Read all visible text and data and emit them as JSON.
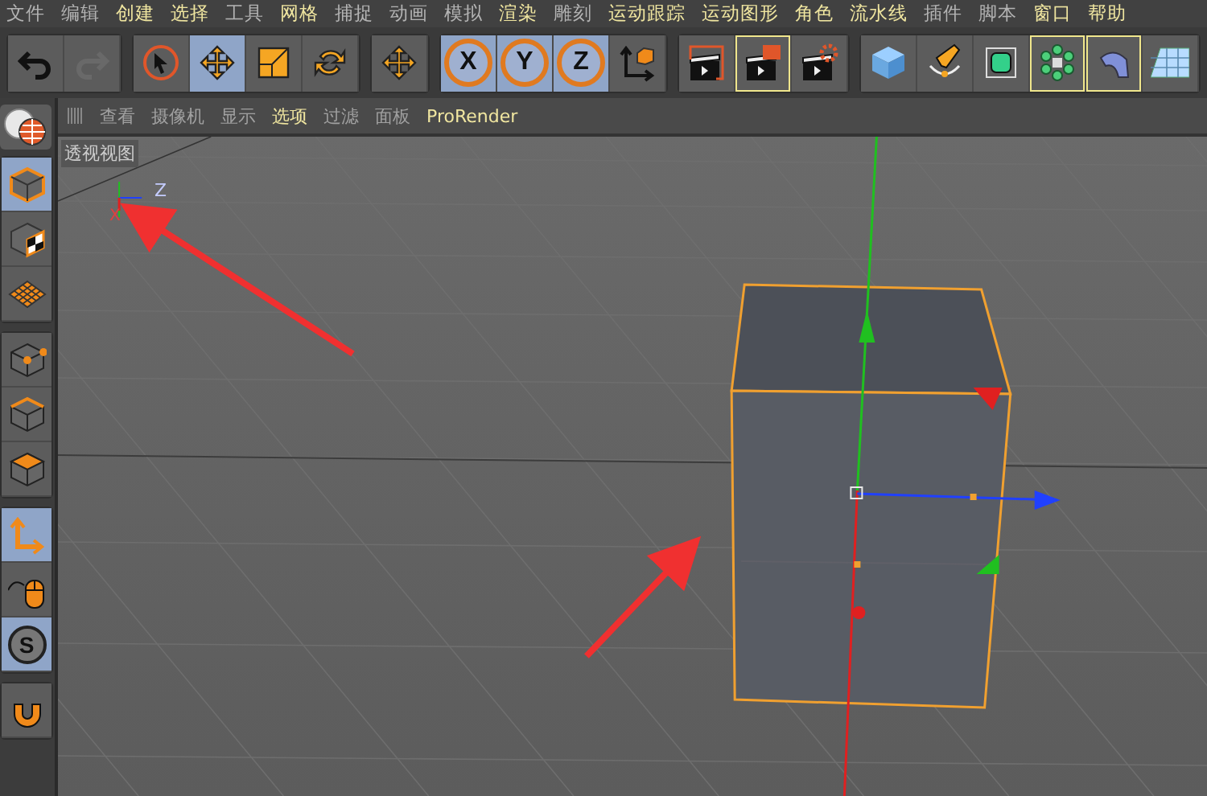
{
  "menu_bar": [
    {
      "label": "文件",
      "color": "#b4b4b4"
    },
    {
      "label": "编辑",
      "color": "#b4b4b4"
    },
    {
      "label": "创建",
      "color": "#f0e6a0"
    },
    {
      "label": "选择",
      "color": "#f0e6a0"
    },
    {
      "label": "工具",
      "color": "#b4b4b4"
    },
    {
      "label": "网格",
      "color": "#f0e6a0"
    },
    {
      "label": "捕捉",
      "color": "#b4b4b4"
    },
    {
      "label": "动画",
      "color": "#b4b4b4"
    },
    {
      "label": "模拟",
      "color": "#b4b4b4"
    },
    {
      "label": "渲染",
      "color": "#f0e6a0"
    },
    {
      "label": "雕刻",
      "color": "#b4b4b4"
    },
    {
      "label": "运动跟踪",
      "color": "#f0e6a0"
    },
    {
      "label": "运动图形",
      "color": "#f0e6a0"
    },
    {
      "label": "角色",
      "color": "#f0e6a0"
    },
    {
      "label": "流水线",
      "color": "#f0e6a0"
    },
    {
      "label": "插件",
      "color": "#b4b4b4"
    },
    {
      "label": "脚本",
      "color": "#b4b4b4"
    },
    {
      "label": "窗口",
      "color": "#f0e6a0"
    },
    {
      "label": "帮助",
      "color": "#f0e6a0"
    }
  ],
  "toolbar": [
    [
      {
        "kind": "undo",
        "selected": false,
        "outlined": false,
        "disabled": false
      },
      {
        "kind": "redo",
        "selected": false,
        "outlined": false,
        "disabled": true
      }
    ],
    [
      {
        "kind": "select",
        "selected": false,
        "outlined": false,
        "disabled": false
      },
      {
        "kind": "move",
        "selected": true,
        "outlined": false,
        "disabled": false
      },
      {
        "kind": "scale",
        "selected": false,
        "outlined": false,
        "disabled": false
      },
      {
        "kind": "rotate",
        "selected": false,
        "outlined": false,
        "disabled": false
      }
    ],
    [
      {
        "kind": "transform",
        "selected": false,
        "outlined": false,
        "disabled": false
      }
    ],
    [
      {
        "kind": "axis-letter",
        "label": "X",
        "selected": true,
        "outlined": false,
        "disabled": false
      },
      {
        "kind": "axis-letter",
        "label": "Y",
        "selected": true,
        "outlined": false,
        "disabled": false
      },
      {
        "kind": "axis-letter",
        "label": "Z",
        "selected": true,
        "outlined": false,
        "disabled": false
      },
      {
        "kind": "coords",
        "selected": false,
        "outlined": false,
        "disabled": false
      }
    ],
    [
      {
        "kind": "render-region",
        "selected": false,
        "outlined": false,
        "disabled": false
      },
      {
        "kind": "render-view",
        "selected": false,
        "outlined": true,
        "disabled": false
      },
      {
        "kind": "render-settings",
        "selected": false,
        "outlined": false,
        "disabled": false
      }
    ],
    [
      {
        "kind": "cube",
        "selected": false,
        "outlined": false,
        "disabled": false
      },
      {
        "kind": "pen",
        "selected": false,
        "outlined": false,
        "disabled": false
      },
      {
        "kind": "subdivision",
        "selected": false,
        "outlined": false,
        "disabled": false
      },
      {
        "kind": "cloner",
        "selected": false,
        "outlined": true,
        "disabled": false
      },
      {
        "kind": "bend",
        "selected": false,
        "outlined": true,
        "disabled": false
      },
      {
        "kind": "floor",
        "selected": false,
        "outlined": false,
        "disabled": false
      }
    ]
  ],
  "viewport_menu": [
    {
      "label": "查看",
      "color": "#a0a0a0"
    },
    {
      "label": "摄像机",
      "color": "#a0a0a0"
    },
    {
      "label": "显示",
      "color": "#a0a0a0"
    },
    {
      "label": "选项",
      "color": "#f0e6a0"
    },
    {
      "label": "过滤",
      "color": "#a0a0a0"
    },
    {
      "label": "面板",
      "color": "#a0a0a0"
    },
    {
      "label": "ProRender",
      "color": "#f0e6a0"
    }
  ],
  "sidebar": [
    [
      {
        "kind": "model",
        "selected": true
      },
      {
        "kind": "texture",
        "selected": false
      },
      {
        "kind": "uv",
        "selected": false
      }
    ],
    [
      {
        "kind": "points",
        "selected": false
      },
      {
        "kind": "edges",
        "selected": false
      },
      {
        "kind": "polygons",
        "selected": false
      }
    ],
    [
      {
        "kind": "axis",
        "selected": true
      },
      {
        "kind": "tweak",
        "selected": false
      },
      {
        "kind": "solo",
        "label": "S",
        "selected": true
      }
    ],
    [
      {
        "kind": "snap",
        "selected": false
      }
    ]
  ],
  "viewport": {
    "title": "透视视图",
    "axis_labels": [
      "Z",
      "X"
    ]
  }
}
